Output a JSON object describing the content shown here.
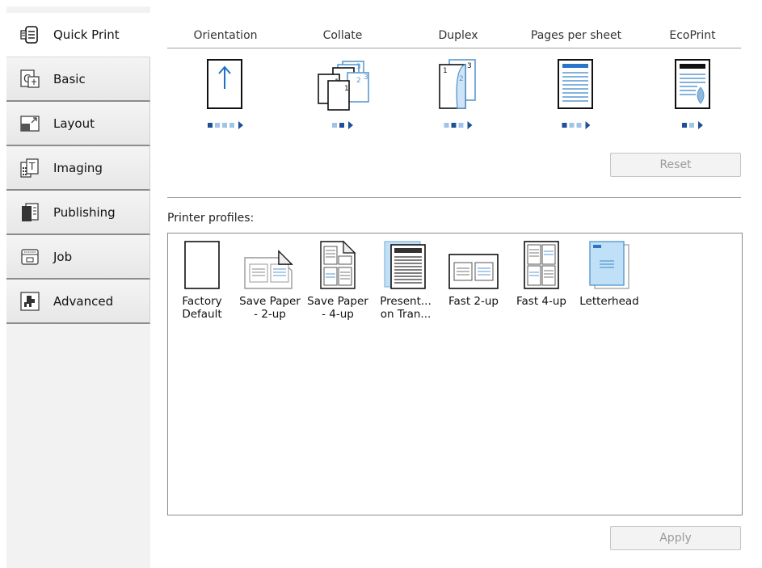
{
  "sidebar": {
    "tabs": [
      {
        "label": "Quick Print",
        "icon": "quick-print-icon",
        "active": true
      },
      {
        "label": "Basic",
        "icon": "basic-icon"
      },
      {
        "label": "Layout",
        "icon": "layout-icon"
      },
      {
        "label": "Imaging",
        "icon": "imaging-icon"
      },
      {
        "label": "Publishing",
        "icon": "publishing-icon"
      },
      {
        "label": "Job",
        "icon": "job-icon"
      },
      {
        "label": "Advanced",
        "icon": "advanced-icon"
      }
    ]
  },
  "features": [
    {
      "label": "Orientation",
      "steps": 4,
      "selected": 1
    },
    {
      "label": "Collate",
      "steps": 2,
      "selected": 1
    },
    {
      "label": "Duplex",
      "steps": 3,
      "selected": 2
    },
    {
      "label": "Pages per sheet",
      "steps": 3,
      "selected": 1
    },
    {
      "label": "EcoPrint",
      "steps": 2,
      "selected": 1
    }
  ],
  "reset_label": "Reset",
  "profiles_label": "Printer profiles:",
  "profiles": [
    {
      "name": "Factory\nDefault",
      "icon": "blank-page-icon"
    },
    {
      "name": "Save Paper\n- 2-up",
      "icon": "save-paper-2up-icon"
    },
    {
      "name": "Save Paper\n- 4-up",
      "icon": "save-paper-4up-icon"
    },
    {
      "name": "Present...\non Tran...",
      "icon": "transparency-icon"
    },
    {
      "name": "Fast 2-up",
      "icon": "fast-2up-icon"
    },
    {
      "name": "Fast 4-up",
      "icon": "fast-4up-icon"
    },
    {
      "name": "Letterhead",
      "icon": "letterhead-icon"
    }
  ],
  "apply_label": "Apply",
  "colors": {
    "accent": "#1e4f9a",
    "light_accent": "#9fc4e8",
    "highlight": "#bfe0f7"
  }
}
